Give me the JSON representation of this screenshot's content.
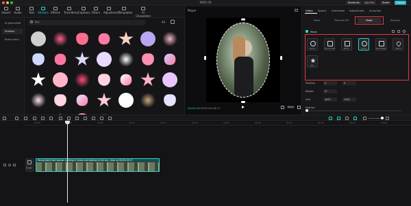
{
  "window": {
    "title": "0605 (9)",
    "buttons": {
      "shortcuts": "Shortcuts",
      "join_pro": "Join Pro",
      "share": "Share",
      "export": "Export"
    }
  },
  "toolbar": {
    "items": [
      "Import",
      "Audio",
      "Text",
      "Stickers",
      "Effects",
      "Transitions",
      "Captions",
      "Filters",
      "Adjustment",
      "Templates",
      "AI Characters"
    ],
    "active": "Stickers"
  },
  "sidebar": {
    "items": [
      "AI generated",
      "Stickers",
      "Brand stick..."
    ]
  },
  "search": {
    "placeholder": "fire",
    "filter_all": "All"
  },
  "stickers": {
    "colors": [
      "#cfcfcf",
      "#ff5f8a",
      "#ff6d8e",
      "#ff7aa2",
      "#f7d2c0",
      "#b9a6f0",
      "#f7b5c8",
      "#cfd8ff",
      "#ff6fa0",
      "#d9d9ff",
      "#e8d9ff",
      "#ffffff",
      "#ff8fb1",
      "#c8d3ff",
      "#ffffff",
      "#ffb5c9",
      "#ff4d7a",
      "#ffd2e0",
      "#ffffff",
      "#ffb0c6",
      "#e9c4ff",
      "#ffe2ea",
      "#ffd6e1",
      "#e0e6ff",
      "#ffc9d8",
      "#ffffff",
      "#c9a87c",
      "#e8e1ff",
      "#ffb3c7",
      "#ffccd8",
      "#ff8fb0",
      "#e6f0ff"
    ]
  },
  "player": {
    "title": "Player",
    "current_time": "00:00:00:23",
    "total_time": "00:00:16:17",
    "ratio": "Ratio"
  },
  "props": {
    "tabs": [
      "Video",
      "Speed",
      "Animation",
      "Adjustment",
      "AI stylize"
    ],
    "active_tab": "Video",
    "subtabs": [
      "Basic",
      "Remove BG",
      "Mask",
      "Retouch"
    ],
    "active_subtab": "Mask",
    "mask_label": "Mask",
    "masks": [
      "None",
      "Horizontal",
      "Mirror",
      "Circle",
      "Rectangle",
      "Heart",
      "Star"
    ],
    "active_mask": "Circle",
    "position_label": "Position",
    "position_x": "0",
    "position_y": "0",
    "rotate_label": "Rotate",
    "rotate_value": "0°",
    "size_label": "Size",
    "size_w": "1637",
    "size_h": "1292",
    "feather_label": "Feather"
  },
  "timeline": {
    "ruler": [
      "00:00",
      "00:03",
      "00:05",
      "00:10",
      "00:15",
      "00:20",
      "00:25",
      "00:30",
      "00:35",
      "00:40",
      "00:45",
      "00:50"
    ],
    "clip_label": "Young blond hair woman walking in forest and looking to the sky, close up 00:00:16:17",
    "cover_label": "Cover"
  }
}
